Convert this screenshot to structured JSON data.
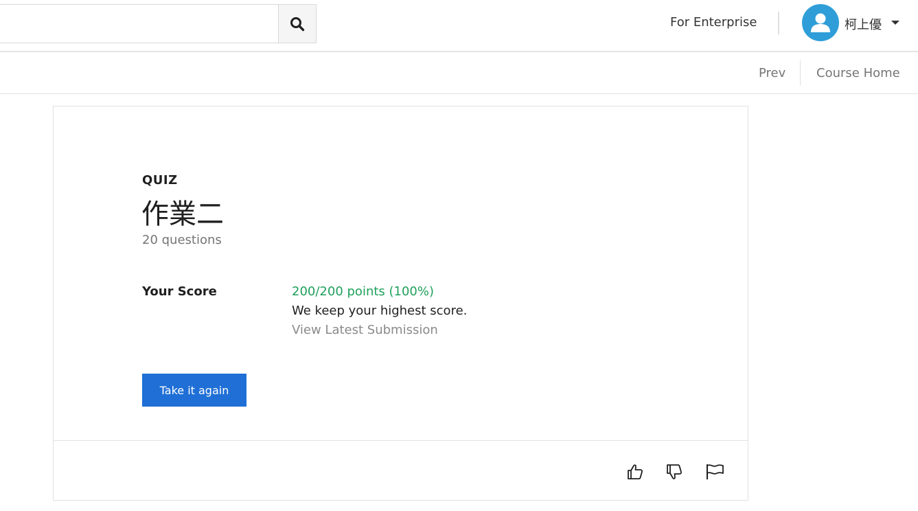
{
  "header": {
    "search": {
      "value": "",
      "placeholder": ""
    },
    "search_icon": "search-icon",
    "enterprise_link": "For Enterprise",
    "user": {
      "name": "柯上優",
      "avatar_icon": "user-icon"
    }
  },
  "subnav": {
    "prev_label": "Prev",
    "course_home_label": "Course Home"
  },
  "quiz": {
    "type_label": "QUIZ",
    "title": "作業二",
    "question_count": "20 questions",
    "score_label": "Your Score",
    "score_value": "200/200 points (100%)",
    "score_note": "We keep your highest score.",
    "view_submission": "View Latest Submission",
    "retake_label": "Take it again"
  },
  "feedback": {
    "icons": [
      "thumbs-up-icon",
      "thumbs-down-icon",
      "flag-icon"
    ]
  },
  "colors": {
    "primary": "#1f6fd6",
    "score_green": "#1fa05b",
    "avatar_blue": "#2f9ed8",
    "muted_text": "#757575"
  }
}
